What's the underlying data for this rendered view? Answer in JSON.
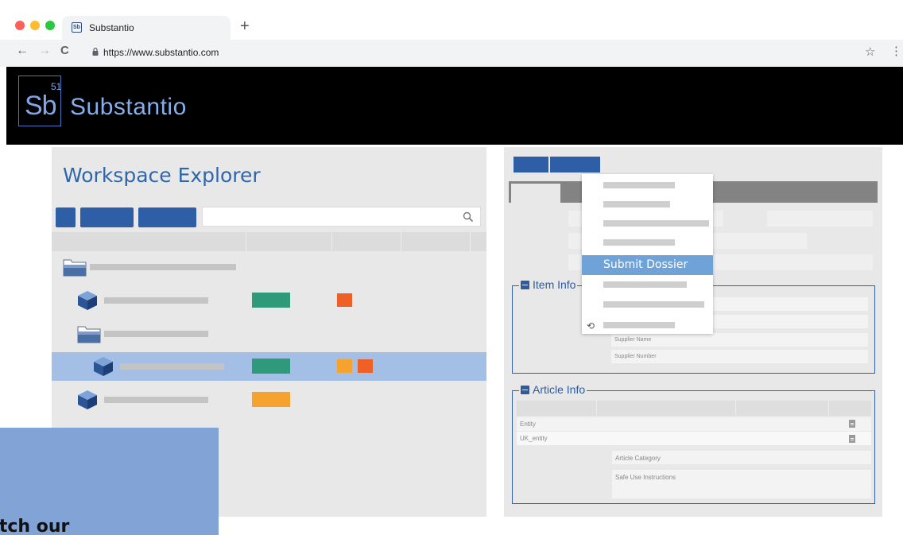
{
  "browser": {
    "tab_title": "Substantio",
    "favicon_text": "Sb",
    "new_tab_glyph": "+",
    "url": "https://www.substantio.com",
    "back_glyph": "←",
    "forward_glyph": "→",
    "reload_glyph": "C",
    "star_glyph": "☆",
    "menu_glyph": "⋮"
  },
  "app": {
    "logo_symbol": "Sb",
    "logo_number": "51",
    "brand_name": "Substantio"
  },
  "workspace": {
    "title": "Workspace Explorer",
    "rows": [
      {
        "type": "folder",
        "selected": false
      },
      {
        "type": "cube",
        "status_tag": "#2f9a7a",
        "flags": [
          "#ef6027"
        ],
        "selected": false
      },
      {
        "type": "folder",
        "selected": false
      },
      {
        "type": "cube",
        "status_tag": "#2f9a7a",
        "flags": [
          "#f6a22f",
          "#ef6027"
        ],
        "selected": true
      },
      {
        "type": "cube",
        "status_tag": "#f6a22f",
        "flags": [],
        "selected": false
      }
    ]
  },
  "dossier_menu": {
    "active_item": "Submit Dossier"
  },
  "item_info": {
    "title": "Item Info",
    "fields": [
      "Supplier Name",
      "Supplier Number"
    ]
  },
  "article_info": {
    "title": "Article Info",
    "rows": [
      "Entity",
      "UK_entity"
    ],
    "fields": [
      "Article Category",
      "Safe Use Instructions"
    ]
  },
  "promo": {
    "text": "atch our"
  },
  "colors": {
    "header_bg": "#000000",
    "accent_blue": "#2e5ea6",
    "selection": "#a3bfe6",
    "menu_highlight": "#6fa3d8",
    "green": "#2f9a7a",
    "orange": "#f6a22f",
    "red_orange": "#ef6027"
  }
}
